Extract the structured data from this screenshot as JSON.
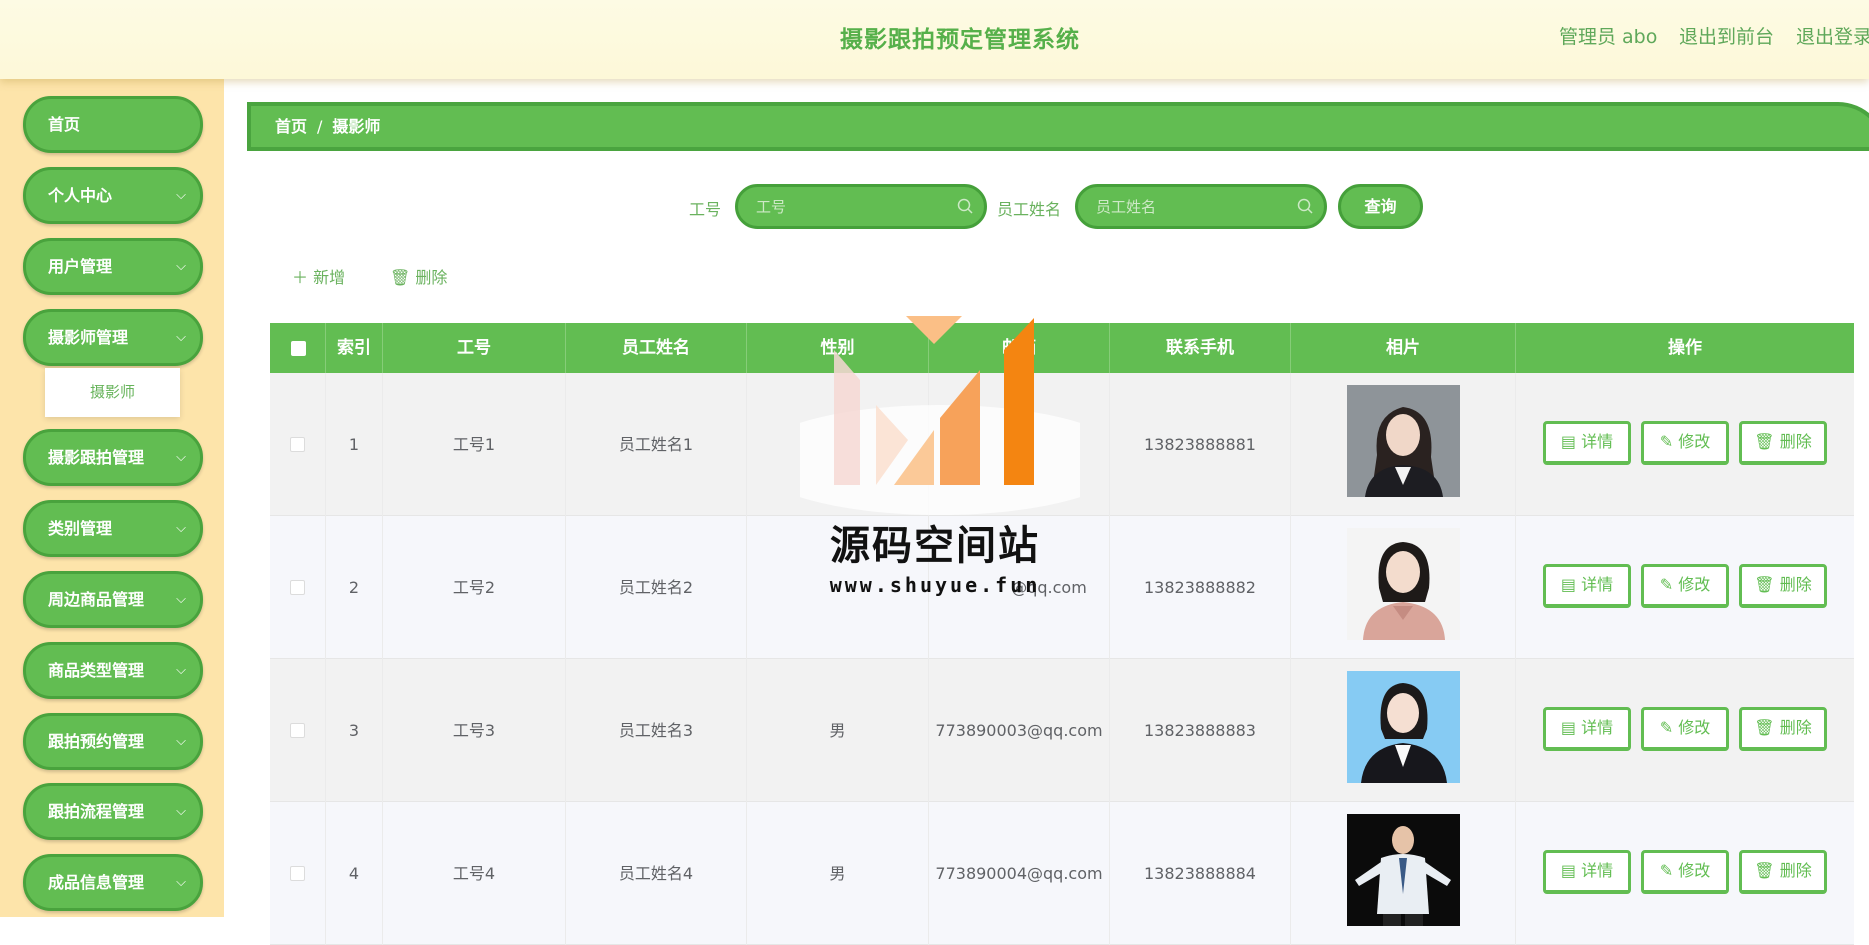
{
  "header": {
    "title": "摄影跟拍预定管理系统",
    "user": "管理员 abo",
    "to_front": "退出到前台",
    "logout": "退出登录"
  },
  "sidebar": {
    "items": [
      {
        "label": "首页",
        "has_children": false
      },
      {
        "label": "个人中心",
        "has_children": true
      },
      {
        "label": "用户管理",
        "has_children": true
      },
      {
        "label": "摄影师管理",
        "has_children": true
      },
      {
        "label": "摄影跟拍管理",
        "has_children": true
      },
      {
        "label": "类别管理",
        "has_children": true
      },
      {
        "label": "周边商品管理",
        "has_children": true
      },
      {
        "label": "商品类型管理",
        "has_children": true
      },
      {
        "label": "跟拍预约管理",
        "has_children": true
      },
      {
        "label": "跟拍流程管理",
        "has_children": true
      },
      {
        "label": "成品信息管理",
        "has_children": true
      }
    ],
    "active_sub": "摄影师"
  },
  "breadcrumb": {
    "home": "首页",
    "sep": "/",
    "current": "摄影师"
  },
  "search": {
    "id_label": "工号",
    "id_placeholder": "工号",
    "name_label": "员工姓名",
    "name_placeholder": "员工姓名",
    "query_label": "查询"
  },
  "actions": {
    "add": "新增",
    "delete": "删除"
  },
  "table": {
    "columns": [
      "索引",
      "工号",
      "员工姓名",
      "性别",
      "邮箱",
      "联系手机",
      "相片",
      "操作"
    ],
    "rows": [
      {
        "index": "1",
        "id": "工号1",
        "name": "员工姓名1",
        "gender": "",
        "email": "",
        "phone": "13823888881",
        "photo": "woman-dark-hair-grey-bg"
      },
      {
        "index": "2",
        "id": "工号2",
        "name": "员工姓名2",
        "gender": "",
        "email": "@qq.com",
        "phone": "13823888882",
        "photo": "woman-pink-blouse-white-bg"
      },
      {
        "index": "3",
        "id": "工号3",
        "name": "员工姓名3",
        "gender": "男",
        "email": "773890003@qq.com",
        "phone": "13823888883",
        "photo": "woman-suit-blue-bg"
      },
      {
        "index": "4",
        "id": "工号4",
        "name": "员工姓名4",
        "gender": "男",
        "email": "773890004@qq.com",
        "phone": "13823888884",
        "photo": "man-white-suit-black-bg"
      }
    ],
    "ops": {
      "detail": "详情",
      "edit": "修改",
      "delete": "删除"
    }
  },
  "watermark": {
    "title": "源码空间站",
    "url": "www.shuyue.fun"
  },
  "colors": {
    "accent": "#62bd52",
    "accent_dark": "#45a03a",
    "sidebar_bg": "#fde4aa",
    "header_bg": "#fdfbe4"
  }
}
